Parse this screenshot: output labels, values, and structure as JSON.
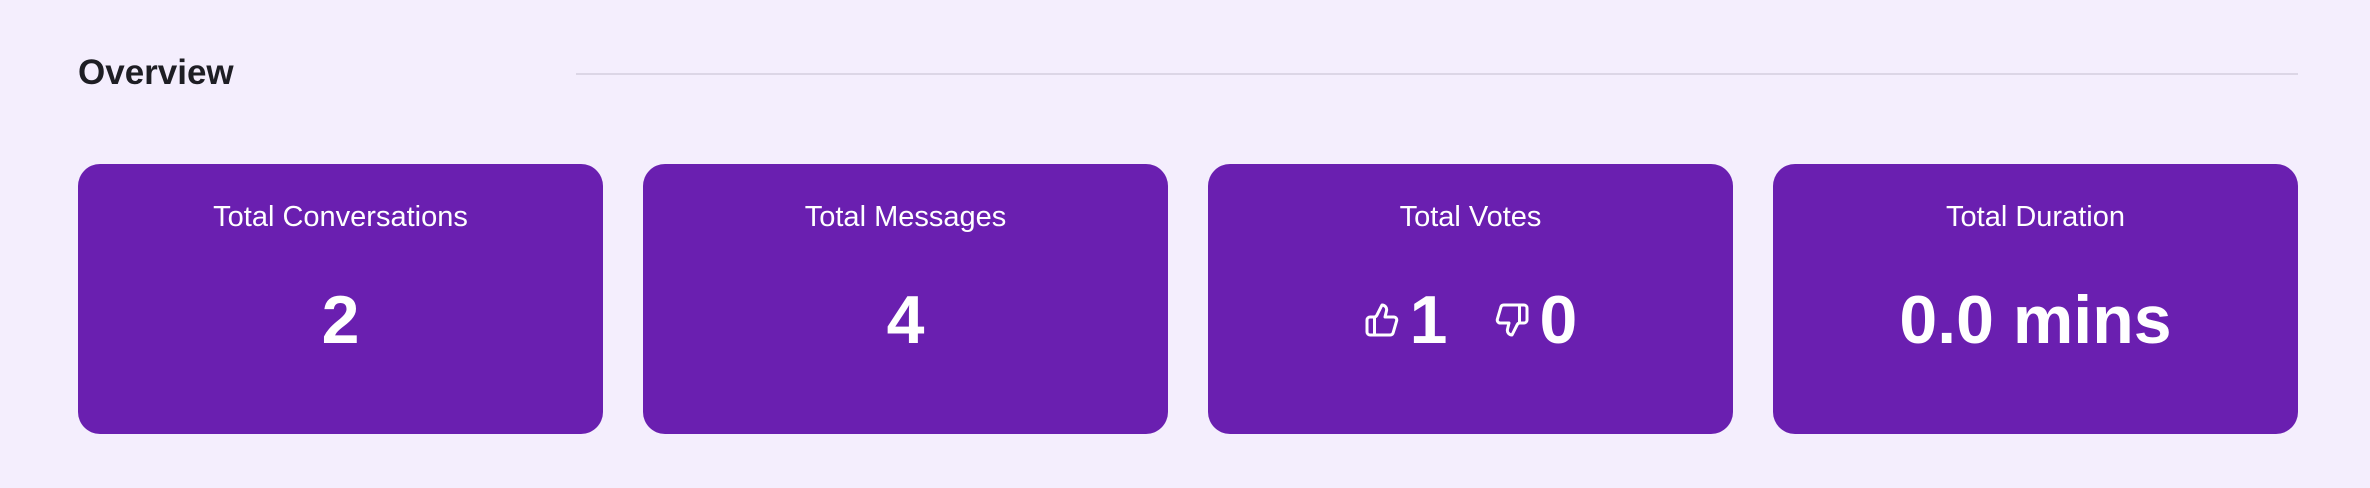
{
  "overview": {
    "title": "Overview"
  },
  "cards": {
    "conversations": {
      "label": "Total Conversations",
      "value": "2"
    },
    "messages": {
      "label": "Total Messages",
      "value": "4"
    },
    "votes": {
      "label": "Total Votes",
      "up_icon": "thumbs-up-icon",
      "up_value": "1",
      "down_icon": "thumbs-down-icon",
      "down_value": "0"
    },
    "duration": {
      "label": "Total Duration",
      "value": "0.0 mins"
    }
  },
  "colors": {
    "background": "#f4eefd",
    "card": "#6a1fb0",
    "card_text": "#ffffff",
    "title_text": "#1e1e24",
    "divider": "#dcd6e6"
  }
}
